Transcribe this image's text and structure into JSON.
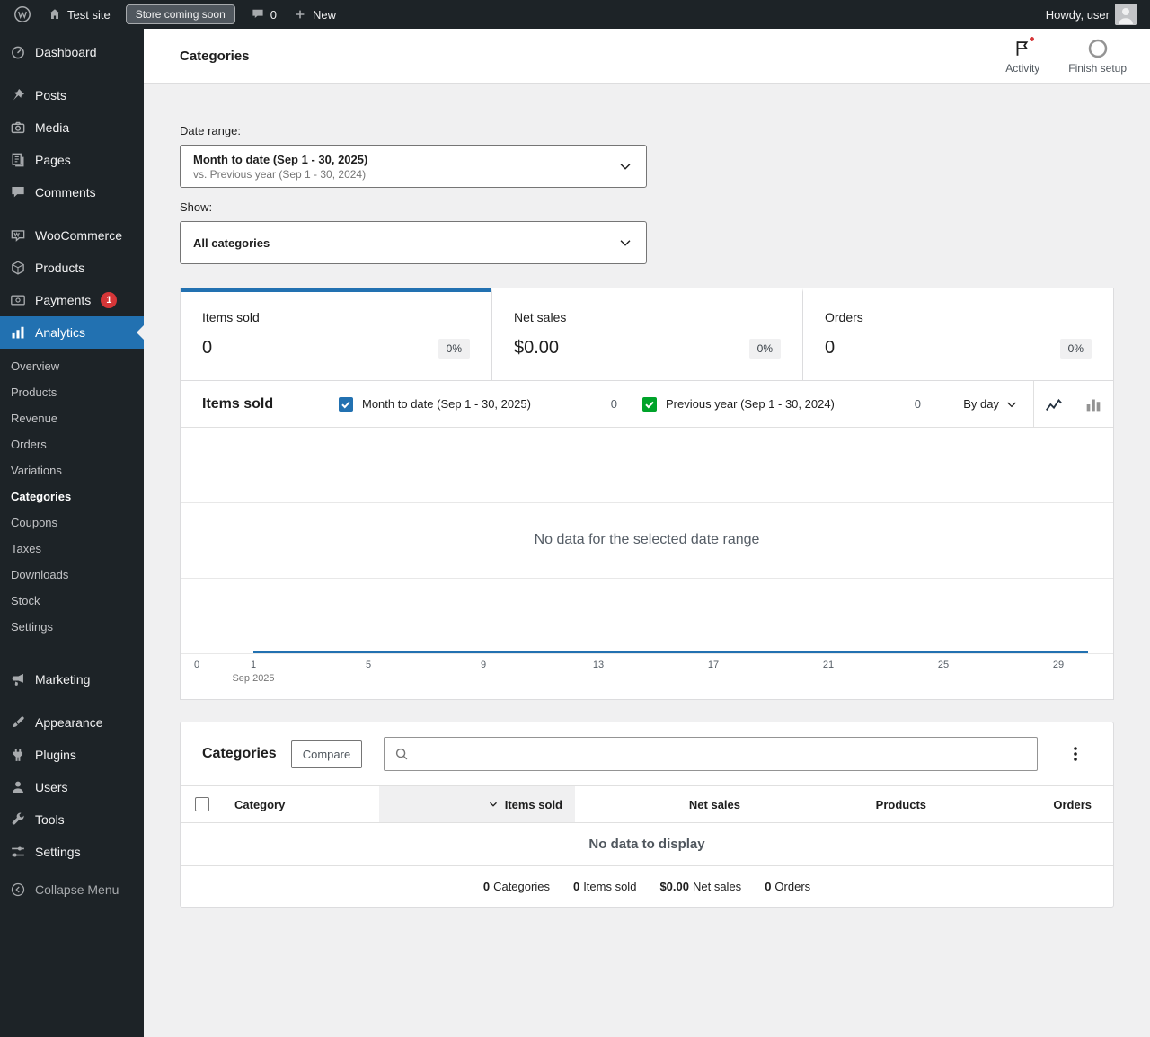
{
  "colors": {
    "accent": "#2271b1",
    "series_current": "#2271b1",
    "series_previous": "#00a32a",
    "notification_red": "#d63638",
    "admin_bar_bg": "#1d2327"
  },
  "admin_bar": {
    "site_name": "Test site",
    "store_badge": "Store coming soon",
    "comments_count": "0",
    "new_label": "New",
    "howdy": "Howdy, user"
  },
  "sidebar": {
    "items": [
      {
        "label": "Dashboard"
      },
      {
        "label": "Posts"
      },
      {
        "label": "Media"
      },
      {
        "label": "Pages"
      },
      {
        "label": "Comments"
      },
      {
        "label": "WooCommerce"
      },
      {
        "label": "Products"
      },
      {
        "label": "Payments",
        "badge": "1"
      },
      {
        "label": "Analytics",
        "active": true
      },
      {
        "label": "Marketing"
      },
      {
        "label": "Appearance"
      },
      {
        "label": "Plugins"
      },
      {
        "label": "Users"
      },
      {
        "label": "Tools"
      },
      {
        "label": "Settings"
      },
      {
        "label": "Collapse Menu"
      }
    ],
    "analytics_submenu": [
      {
        "label": "Overview"
      },
      {
        "label": "Products"
      },
      {
        "label": "Revenue"
      },
      {
        "label": "Orders"
      },
      {
        "label": "Variations"
      },
      {
        "label": "Categories",
        "active": true
      },
      {
        "label": "Coupons"
      },
      {
        "label": "Taxes"
      },
      {
        "label": "Downloads"
      },
      {
        "label": "Stock"
      },
      {
        "label": "Settings"
      }
    ]
  },
  "header": {
    "title": "Categories",
    "activity_label": "Activity",
    "finish_setup_label": "Finish setup"
  },
  "filters": {
    "date_range_label": "Date range:",
    "date_range_primary": "Month to date (Sep 1 - 30, 2025)",
    "date_range_secondary": "vs. Previous year (Sep 1 - 30, 2024)",
    "show_label": "Show:",
    "show_value": "All categories"
  },
  "summary_stats": [
    {
      "label": "Items sold",
      "value": "0",
      "delta": "0%",
      "selected": true
    },
    {
      "label": "Net sales",
      "value": "$0.00",
      "delta": "0%"
    },
    {
      "label": "Orders",
      "value": "0",
      "delta": "0%"
    }
  ],
  "chart": {
    "title": "Items sold",
    "legend": [
      {
        "label": "Month to date (Sep 1 - 30, 2025)",
        "value": "0",
        "color": "#2271b1",
        "checked": true
      },
      {
        "label": "Previous year (Sep 1 - 30, 2024)",
        "value": "0",
        "color": "#00a32a",
        "checked": true
      }
    ],
    "interval": "By day",
    "empty_message": "No data for the selected date range",
    "y_zero_label": "0",
    "x_ticks": [
      "1",
      "5",
      "9",
      "13",
      "17",
      "21",
      "25",
      "29"
    ],
    "x_axis_label": "Sep 2025"
  },
  "chart_data": {
    "type": "line",
    "title": "Items sold",
    "x_axis_label": "Sep 2025",
    "x_ticks": [
      1,
      5,
      9,
      13,
      17,
      21,
      25,
      29
    ],
    "series": [
      {
        "name": "Month to date (Sep 1 - 30, 2025)",
        "total": 0,
        "values": []
      },
      {
        "name": "Previous year (Sep 1 - 30, 2024)",
        "total": 0,
        "values": []
      }
    ],
    "empty": true,
    "empty_message": "No data for the selected date range"
  },
  "categories_table": {
    "title": "Categories",
    "compare_label": "Compare",
    "search_placeholder": "",
    "columns": [
      {
        "label": "Category",
        "align": "left"
      },
      {
        "label": "Items sold",
        "sorted": "desc"
      },
      {
        "label": "Net sales"
      },
      {
        "label": "Products"
      },
      {
        "label": "Orders"
      }
    ],
    "empty_message": "No data to display",
    "summary": [
      {
        "value": "0",
        "label": "Categories"
      },
      {
        "value": "0",
        "label": "Items sold"
      },
      {
        "value": "$0.00",
        "label": "Net sales"
      },
      {
        "value": "0",
        "label": "Orders"
      }
    ]
  }
}
